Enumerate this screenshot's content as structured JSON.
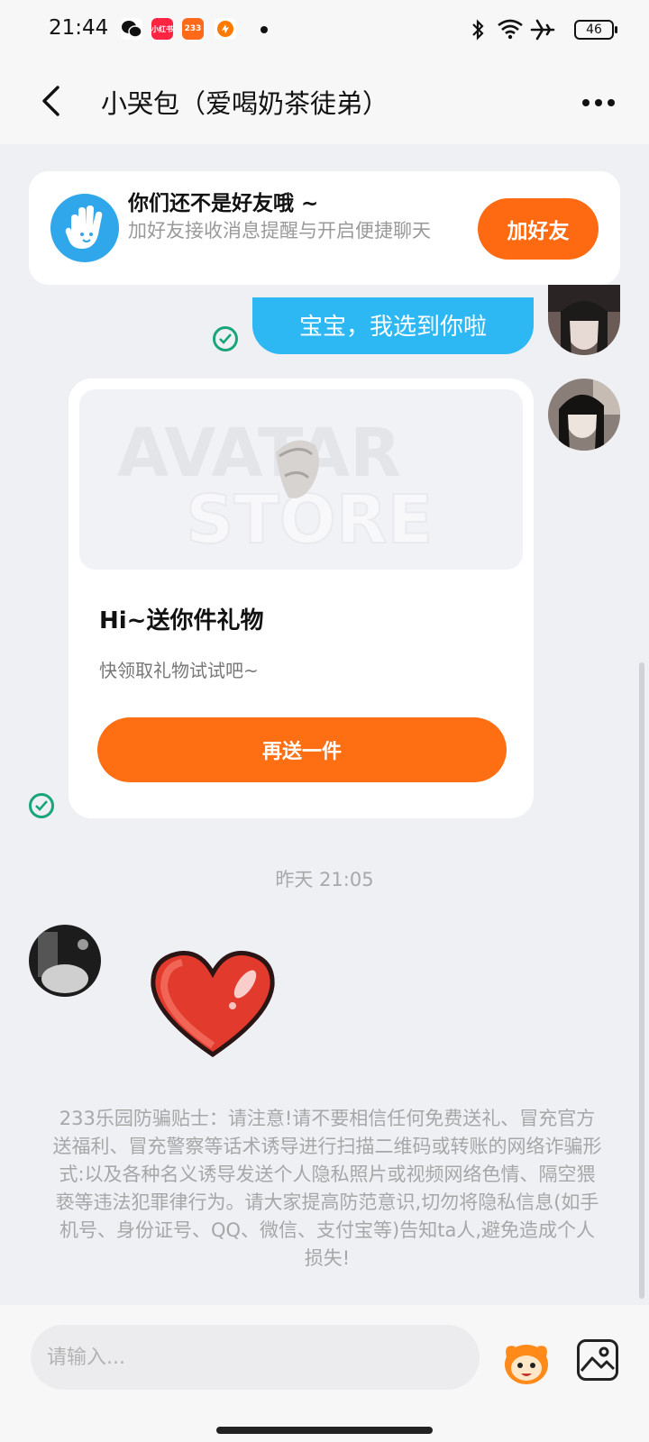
{
  "status_bar": {
    "time": "21:44",
    "apps": [
      "微信",
      "小红书",
      "233",
      "app"
    ],
    "battery": "46"
  },
  "header": {
    "title": "小哭包（爱喝奶茶徒弟）"
  },
  "friend_banner": {
    "title": "你们还不是好友哦 ~",
    "subtitle": "加好友接收消息提醒与开启便捷聊天",
    "button": "加好友"
  },
  "messages": {
    "text_message": "宝宝，我选到你啦",
    "gift_card": {
      "image_text_top": "AVATAR",
      "image_text_bottom": "STORE",
      "title": "Hi~送你件礼物",
      "subtitle": "快领取礼物试试吧~",
      "button": "再送一件"
    },
    "timestamp": "昨天 21:05",
    "incoming_sticker": "heart"
  },
  "notice": "233乐园防骗贴士：请注意!请不要相信任何免费送礼、冒充官方送福利、冒充警察等话术诱导进行扫描二维码或转账的网络诈骗形式:以及各种名义诱导发送个人隐私照片或视频网络色情、隔空猥亵等违法犯罪律行为。请大家提高防范意识,切勿将隐私信息(如手机号、身份证号、QQ、微信、支付宝等)告知ta人,避免造成个人损失!",
  "input": {
    "placeholder": "请输入..."
  },
  "colors": {
    "accent_orange": "#fe6a12",
    "bubble_blue": "#2db8f3",
    "check_green": "#19a57a"
  }
}
